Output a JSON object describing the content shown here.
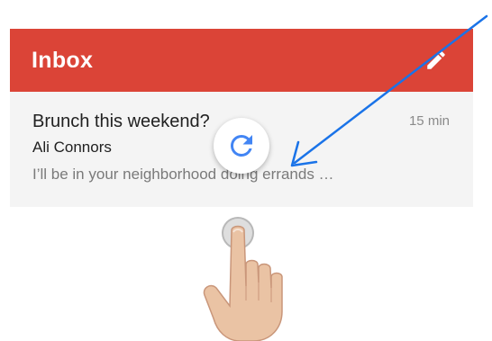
{
  "app_bar": {
    "title": "Inbox",
    "compose_icon": "pencil-icon",
    "color": "#db4437"
  },
  "email": {
    "subject": "Brunch this weekend?",
    "time": "15 min",
    "sender": "Ali Connors",
    "snippet": "I’ll be in your neighborhood doing errands …"
  },
  "refresh": {
    "icon": "refresh-icon",
    "color": "#4285f4"
  },
  "annotation": {
    "arrow_color": "#1a73e8",
    "gesture": "hand-pointer-icon"
  }
}
